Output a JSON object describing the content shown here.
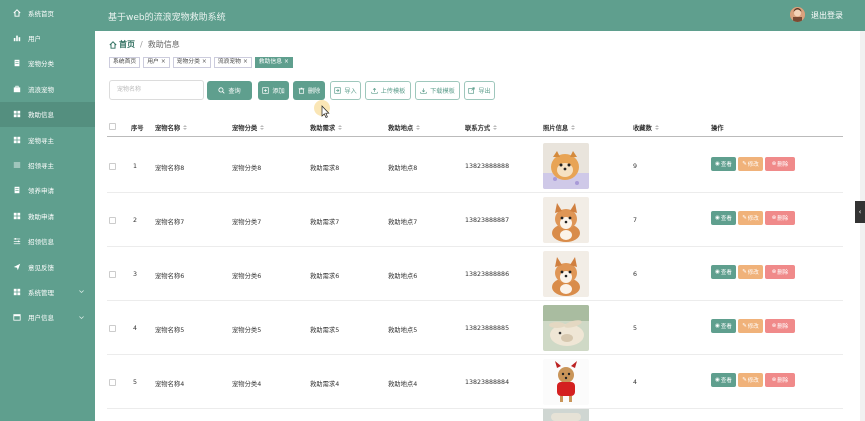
{
  "sidebar": {
    "items": [
      {
        "label": "系统首页",
        "icon": "home-icon"
      },
      {
        "label": "用户",
        "icon": "chart-icon"
      },
      {
        "label": "宠物分类",
        "icon": "doc-icon"
      },
      {
        "label": "流浪宠物",
        "icon": "briefcase-icon"
      },
      {
        "label": "救助信息",
        "icon": "grid-icon"
      },
      {
        "label": "宠物寻主",
        "icon": "grid-icon"
      },
      {
        "label": "招领寻主",
        "icon": "list-icon"
      },
      {
        "label": "领养申请",
        "icon": "doc-icon"
      },
      {
        "label": "救助申请",
        "icon": "grid-icon"
      },
      {
        "label": "招领信息",
        "icon": "sliders-icon"
      },
      {
        "label": "意见反馈",
        "icon": "send-icon"
      },
      {
        "label": "系统管理",
        "icon": "grid-icon",
        "expandable": true
      },
      {
        "label": "用户信息",
        "icon": "calendar-icon",
        "expandable": true
      }
    ]
  },
  "header": {
    "title": "基于web的流浪宠物救助系统",
    "logout": "退出登录"
  },
  "breadcrumb": {
    "home": "首页",
    "separator": "/",
    "current": "救助信息"
  },
  "tags": [
    "系统首页",
    "用户",
    "宠物分类",
    "流浪宠物",
    "救助信息"
  ],
  "toolbar": {
    "search_placeholder": "宠物名称",
    "query": "查询",
    "add": "添加",
    "delete": "删除",
    "import": "导入",
    "upload_template": "上传模板",
    "download_template": "下载模板",
    "export": "导出"
  },
  "table": {
    "headers": {
      "index": "序号",
      "name": "宠物名称",
      "category": "宠物分类",
      "needs": "救助需求",
      "location": "救助地点",
      "contact": "联系方式",
      "image": "照片信息",
      "favorites": "收藏数",
      "actions": "操作"
    },
    "rows": [
      {
        "index": "1",
        "name": "宠物名称8",
        "category": "宠物分类8",
        "needs": "救助需求8",
        "location": "救助地点8",
        "contact": "13823888888",
        "favorites": "9",
        "pet": "pomeranian"
      },
      {
        "index": "2",
        "name": "宠物名称7",
        "category": "宠物分类7",
        "needs": "救助需求7",
        "location": "救助地点7",
        "contact": "13823888887",
        "favorites": "7",
        "pet": "corgi"
      },
      {
        "index": "3",
        "name": "宠物名称6",
        "category": "宠物分类6",
        "needs": "救助需求6",
        "location": "救助地点6",
        "contact": "13823888886",
        "favorites": "6",
        "pet": "corgi"
      },
      {
        "index": "4",
        "name": "宠物名称5",
        "category": "宠物分类5",
        "needs": "救助需求5",
        "location": "救助地点5",
        "contact": "13823888885",
        "favorites": "5",
        "pet": "rabbit"
      },
      {
        "index": "5",
        "name": "宠物名称4",
        "category": "宠物分类4",
        "needs": "救助需求4",
        "location": "救助地点4",
        "contact": "13823888884",
        "favorites": "4",
        "pet": "terrier"
      }
    ],
    "action_labels": {
      "view": "查看",
      "edit": "修改",
      "delete": "删除"
    }
  },
  "colors": {
    "sidebar": "#5f9f8e",
    "accent": "#5f9f8e",
    "edit": "#f0b27a",
    "delete": "#f08a8a"
  }
}
